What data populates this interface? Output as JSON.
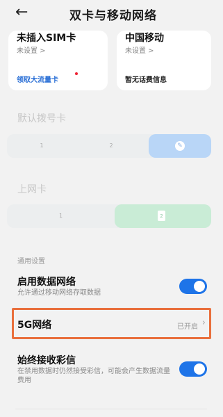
{
  "header": {
    "title": "双卡与移动网络",
    "back_icon": "arrow-left-icon"
  },
  "sim_cards": [
    {
      "name": "未插入SIM卡",
      "status": "未设置 >",
      "action": "领取大流量卡",
      "action_color": "#2a6fd6",
      "has_badge": true
    },
    {
      "name": "中国移动",
      "status": "未设置 >",
      "action": "暂无话费信息",
      "action_color": "#222222",
      "has_badge": false
    }
  ],
  "default_dial": {
    "label": "默认拨号卡",
    "options": [
      "1",
      "2"
    ],
    "selected_icon": "pencil-icon",
    "selected_color": "#b9d6f7"
  },
  "data_card": {
    "label": "上网卡",
    "options": [
      "1"
    ],
    "selected_label": "2",
    "selected_color": "#c9ecd6"
  },
  "general": {
    "label": "通用设置",
    "data_network": {
      "title": "启用数据网络",
      "subtitle": "允许通过移动网络存取数据",
      "enabled": true
    },
    "five_g": {
      "title": "5G网络",
      "value": "已开启"
    },
    "mms": {
      "title": "始终接收彩信",
      "subtitle": "在禁用数据时仍然接受彩信，可能会产生数据流量费用",
      "enabled": true
    }
  },
  "colors": {
    "accent": "#1e74e8",
    "highlight": "#e96f3c"
  }
}
